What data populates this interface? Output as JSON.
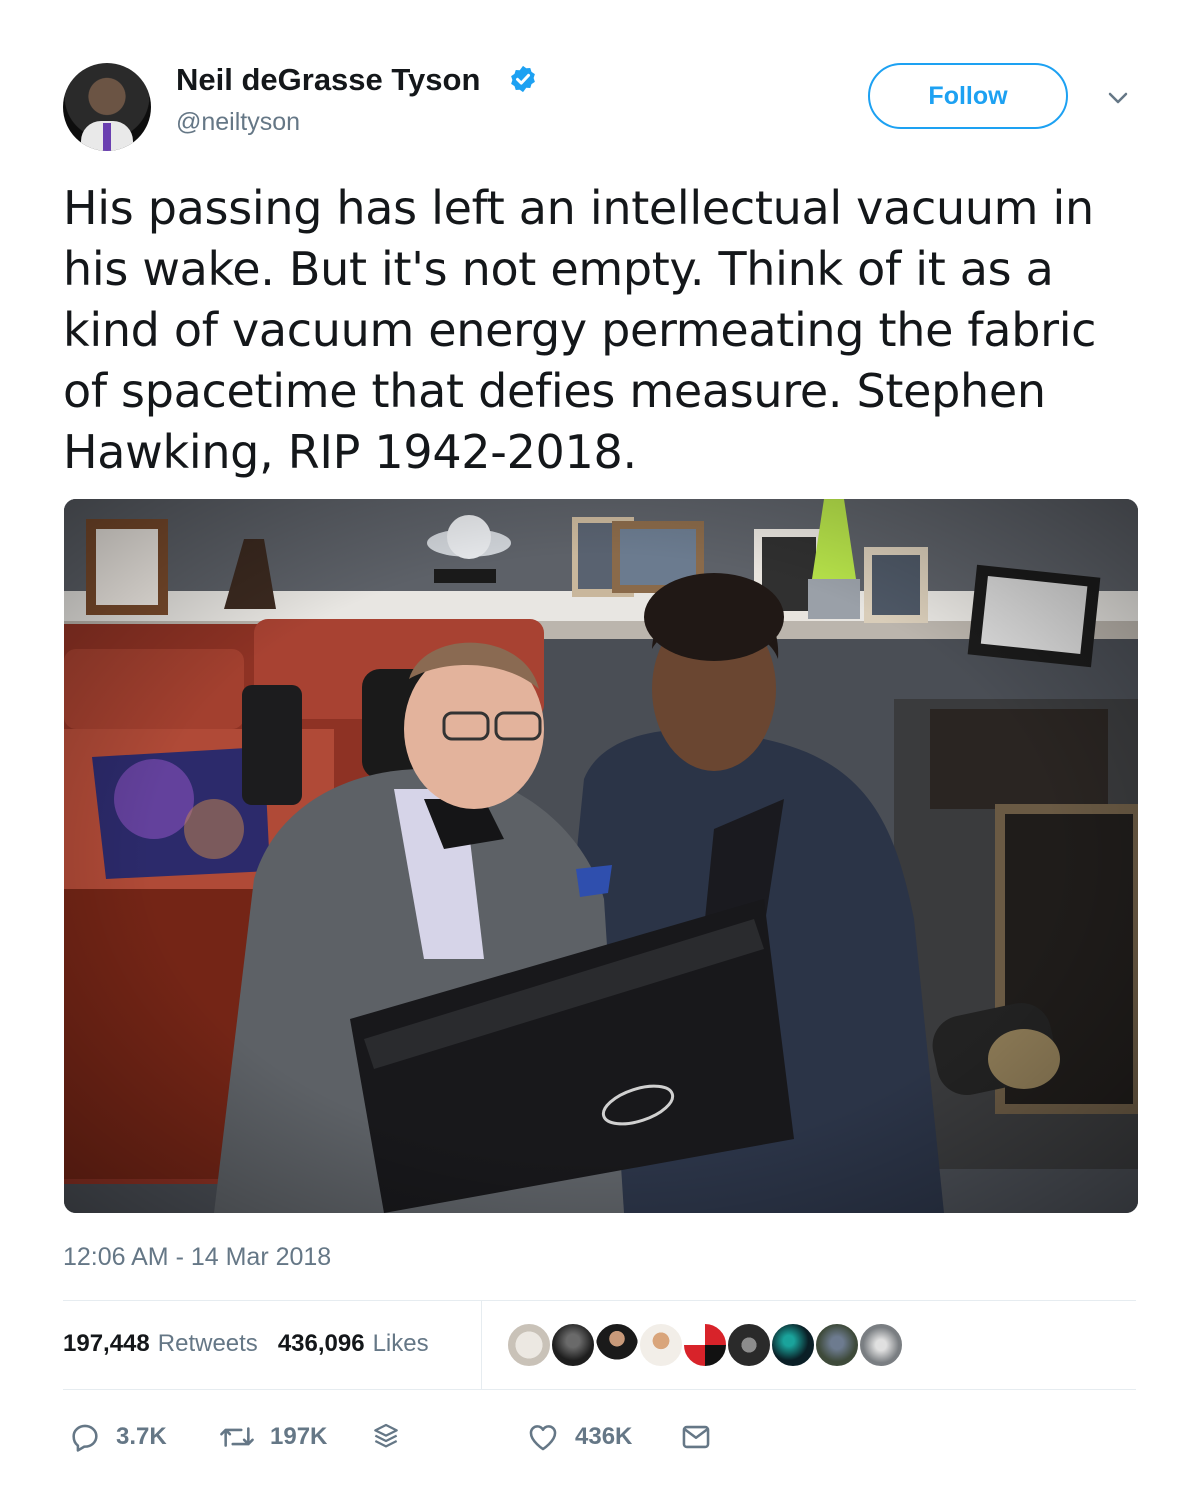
{
  "header": {
    "display_name": "Neil deGrasse Tyson",
    "handle": "@neiltyson",
    "follow_label": "Follow",
    "verified": true,
    "icons": {
      "verified": "verified-badge-icon",
      "more": "chevron-down-icon"
    }
  },
  "tweet": {
    "text": "His passing has left an intellectual vacuum in his wake. But it's not empty. Think of it as a kind of vacuum energy permeating the fabric of spacetime that defies measure. Stephen Hawking, RIP 1942-2018.",
    "timestamp": "12:06 AM - 14 Mar 2018"
  },
  "stats": {
    "retweets_count": "197,448",
    "retweets_label": "Retweets",
    "likes_count": "436,096",
    "likes_label": "Likes",
    "liker_avatar_count": 9
  },
  "actions": {
    "replies": "3.7K",
    "retweets": "197K",
    "likes": "436K",
    "icons": [
      "reply-icon",
      "retweet-icon",
      "stack-icon",
      "heart-icon",
      "envelope-icon"
    ]
  },
  "colors": {
    "accent": "#1da1f2",
    "text_primary": "#14171a",
    "text_secondary": "#657786",
    "divider": "#e6ecf0"
  }
}
